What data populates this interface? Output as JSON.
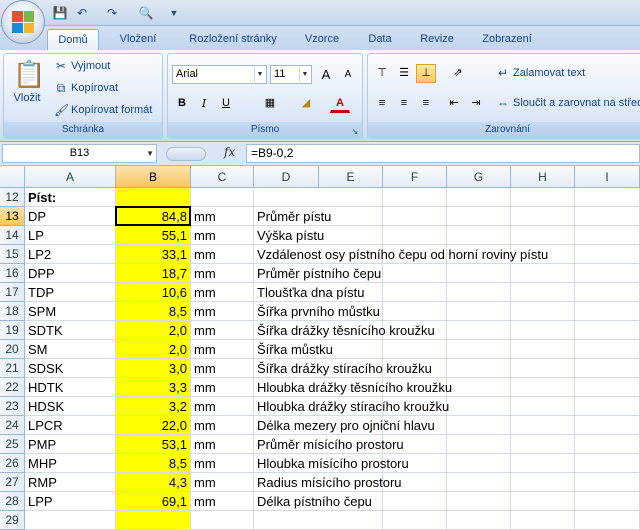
{
  "qat_icons": [
    "save-icon",
    "undo-icon",
    "redo-icon",
    "print-preview-icon",
    "customize-icon"
  ],
  "tabs": [
    "Domů",
    "Vložení",
    "Rozložení stránky",
    "Vzorce",
    "Data",
    "Revize",
    "Zobrazení"
  ],
  "active_tab": "Domů",
  "ribbon": {
    "clipboard": {
      "label": "Schránka",
      "paste": "Vložit",
      "cut": "Vyjmout",
      "copy": "Kopírovat",
      "format_painter": "Kopírovat formát"
    },
    "font": {
      "label": "Písmo",
      "font_name": "Arial",
      "font_size": "11",
      "bold": "B",
      "italic": "I",
      "underline": "U",
      "grow": "A",
      "shrink": "A",
      "font_color": "A"
    },
    "alignment": {
      "label": "Zarovnání",
      "wrap": "Zalamovat text",
      "merge": "Sloučit a zarovnat na střed"
    }
  },
  "formula_bar": {
    "name_box": "B13",
    "fx": "fx",
    "formula": "=B9-0,2"
  },
  "columns": [
    "A",
    "B",
    "C",
    "D",
    "E",
    "F",
    "G",
    "H",
    "I"
  ],
  "selected_column": "B",
  "selected_row": "13",
  "rows": [
    {
      "num": "12",
      "a": "Píst:",
      "b": "",
      "c": "",
      "d": ""
    },
    {
      "num": "13",
      "a": "DP",
      "b": "84,8",
      "c": "mm",
      "d": "Průměr pístu"
    },
    {
      "num": "14",
      "a": "LP",
      "b": "55,1",
      "c": "mm",
      "d": "Výška pístu"
    },
    {
      "num": "15",
      "a": "LP2",
      "b": "33,1",
      "c": "mm",
      "d": "Vzdálenost osy pístního čepu od horní roviny pístu"
    },
    {
      "num": "16",
      "a": "DPP",
      "b": "18,7",
      "c": "mm",
      "d": "Průměr pístního čepu"
    },
    {
      "num": "17",
      "a": "TDP",
      "b": "10,6",
      "c": "mm",
      "d": "Tloušťka dna pístu"
    },
    {
      "num": "18",
      "a": "SPM",
      "b": "8,5",
      "c": "mm",
      "d": "Šířka prvního můstku"
    },
    {
      "num": "19",
      "a": "SDTK",
      "b": "2,0",
      "c": "mm",
      "d": "Šířka drážky těsnícího kroužku"
    },
    {
      "num": "20",
      "a": "SM",
      "b": "2,0",
      "c": "mm",
      "d": "Šířka můstku"
    },
    {
      "num": "21",
      "a": "SDSK",
      "b": "3,0",
      "c": "mm",
      "d": "Šířka drážky stíracího kroužku"
    },
    {
      "num": "22",
      "a": "HDTK",
      "b": "3,3",
      "c": "mm",
      "d": "Hloubka drážky těsnícího kroužku"
    },
    {
      "num": "23",
      "a": "HDSK",
      "b": "3,2",
      "c": "mm",
      "d": "Hloubka drážky stíracího kroužku"
    },
    {
      "num": "24",
      "a": "LPCR",
      "b": "22,0",
      "c": "mm",
      "d": "Délka mezery pro ojniční hlavu"
    },
    {
      "num": "25",
      "a": "PMP",
      "b": "53,1",
      "c": "mm",
      "d": "Průměr mísícího prostoru"
    },
    {
      "num": "26",
      "a": "MHP",
      "b": "8,5",
      "c": "mm",
      "d": "Hloubka mísícího prostoru"
    },
    {
      "num": "27",
      "a": "RMP",
      "b": "4,3",
      "c": "mm",
      "d": "Radius mísícího prostoru"
    },
    {
      "num": "28",
      "a": "LPP",
      "b": "69,1",
      "c": "mm",
      "d": "Délka pístního čepu"
    },
    {
      "num": "29",
      "a": "",
      "b": "",
      "c": "",
      "d": ""
    }
  ],
  "colors": {
    "highlight": "#ffff00",
    "selection_header": "#f8c561",
    "ribbon_blue": "#15428b"
  }
}
